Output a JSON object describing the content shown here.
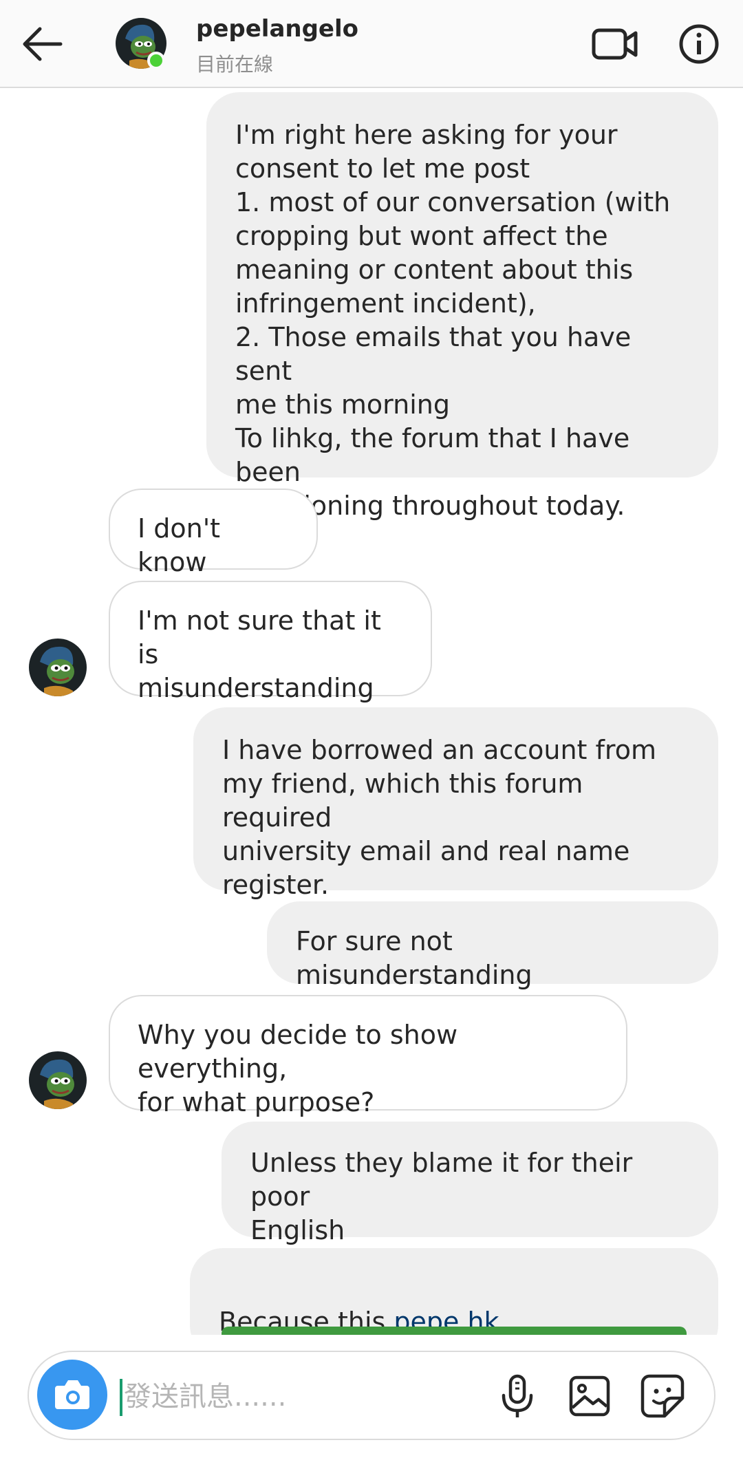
{
  "header": {
    "username": "pepelangelo",
    "status": "目前在線"
  },
  "messages": [
    {
      "side": "out",
      "text": "I'm right here asking for your\nconsent to let me post\n1. most of our conversation (with\ncropping but wont affect the\nmeaning or content about this\ninfringement incident),\n2. Those emails that you have sent\nme this morning\nTo lihkg, the forum that I have been\nmentioning throughout today."
    },
    {
      "side": "in",
      "text": "I don't know"
    },
    {
      "side": "in",
      "text": "I'm not sure that it is\nmisunderstanding"
    },
    {
      "side": "out",
      "text": "I have borrowed an account from\nmy friend, which this forum required\nuniversity email and real name\nregister."
    },
    {
      "side": "out",
      "text": "For sure not misunderstanding"
    },
    {
      "side": "in",
      "text": "Why you decide to show everything,\nfor what purpose?"
    },
    {
      "side": "out",
      "text": "Unless they blame it for their poor\nEnglish"
    },
    {
      "side": "out",
      "text": "Because this ",
      "link": "pepe.hk"
    }
  ],
  "composer": {
    "placeholder": "發送訊息......"
  },
  "colors": {
    "accent": "#3897f0",
    "online": "#4cd137",
    "link": "#00376b",
    "outgoing_bubble": "#efefef"
  },
  "icons": [
    "back-arrow-icon",
    "video-call-icon",
    "info-icon",
    "camera-icon",
    "microphone-icon",
    "gallery-icon",
    "sticker-icon"
  ]
}
